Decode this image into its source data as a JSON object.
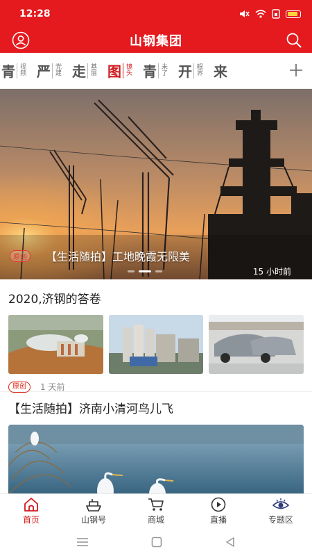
{
  "status_bar": {
    "time": "12:28"
  },
  "app_bar": {
    "title": "山钢集团"
  },
  "channels": [
    {
      "big": "青",
      "small": "视频"
    },
    {
      "big": "严",
      "small": "党建"
    },
    {
      "big": "走",
      "small": "基层"
    },
    {
      "big": "图",
      "small": "镜头",
      "active": true
    },
    {
      "big": "青",
      "small": "未了"
    },
    {
      "big": "开",
      "small": "眼界"
    },
    {
      "big": "来",
      "small": ""
    }
  ],
  "banner": {
    "badge": "原创",
    "caption": "【生活随拍】工地晚霞无限美",
    "time": "15 小时前"
  },
  "article1": {
    "title": "2020,济钢的答卷",
    "tag": "原创",
    "time": "1 天前"
  },
  "article2": {
    "title": "【生活随拍】济南小清河鸟儿飞"
  },
  "tabs": [
    {
      "label": "首页",
      "icon": "home-icon",
      "active": true
    },
    {
      "label": "山钢号",
      "icon": "ship-icon"
    },
    {
      "label": "商城",
      "icon": "cart-icon"
    },
    {
      "label": "直播",
      "icon": "play-icon"
    },
    {
      "label": "专题区",
      "icon": "eye-icon"
    }
  ],
  "colors": {
    "brand": "#e41a1f",
    "active_tab": "#d01a1f"
  }
}
